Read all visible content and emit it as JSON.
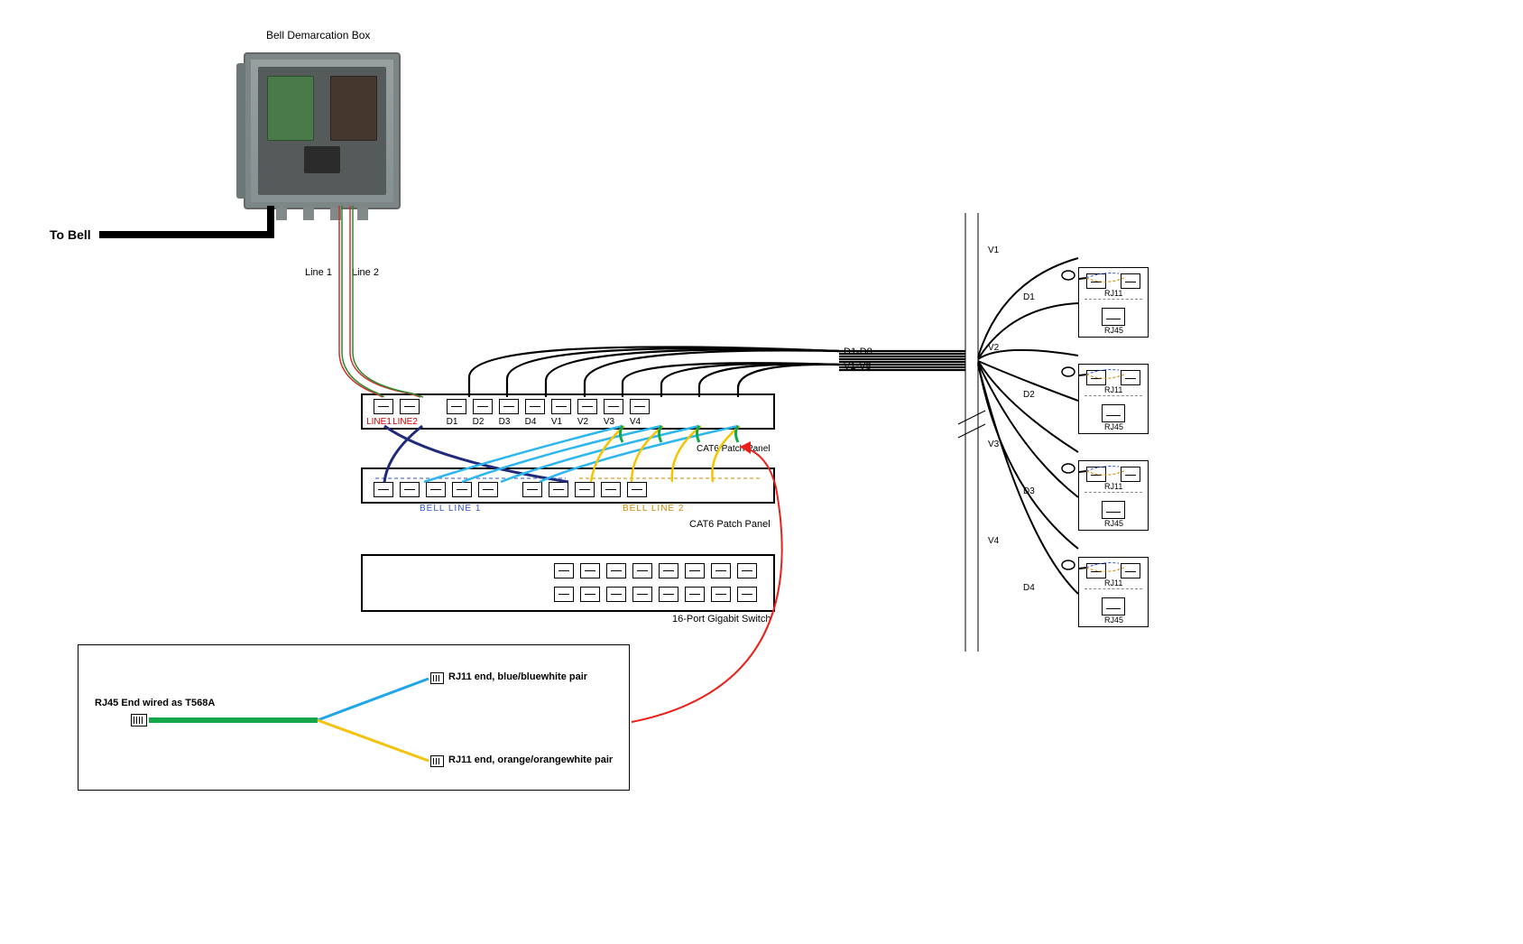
{
  "title": "Bell Demarcation Box",
  "to_bell": "To Bell",
  "line1": "Line 1",
  "line2": "Line 2",
  "patch_panel_1_label": "",
  "cat6_label_inline": "CAT6 Patch Panel",
  "cat6_label2": "CAT6 Patch Panel",
  "switch_label": "16-Port Gigabit Switch",
  "bundles": {
    "d": "D1-D8",
    "v": "V1-V8"
  },
  "patch1_ports": [
    "LINE1",
    "LINE2",
    "D1",
    "D2",
    "D3",
    "D4",
    "V1",
    "V2",
    "V3",
    "V4"
  ],
  "pp2_left": "BELL LINE 1",
  "pp2_right": "BELL LINE 2",
  "legend": {
    "rj45": "RJ45 End wired as T568A",
    "rj11_blue": "RJ11 end, blue/bluewhite pair",
    "rj11_orange": "RJ11 end, orange/orangewhite pair"
  },
  "wallplates": [
    {
      "v": "V1",
      "d": "D1"
    },
    {
      "v": "V2",
      "d": "D2"
    },
    {
      "v": "V3",
      "d": "D3"
    },
    {
      "v": "V4",
      "d": "D4"
    }
  ],
  "rj11": "RJ11",
  "rj45": "RJ45"
}
